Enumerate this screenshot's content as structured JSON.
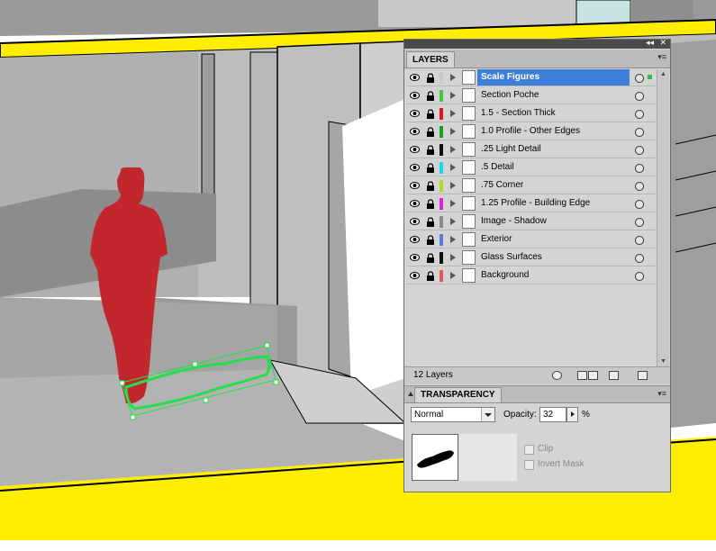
{
  "layers_panel": {
    "tab_label": "LAYERS",
    "collapse_glyph": "◂◂",
    "close_glyph": "✕",
    "menu_glyph": "▾≡",
    "count_label": "12 Layers",
    "layers": [
      {
        "label": "Scale Figures",
        "color": "#c8ccc8",
        "selected": true
      },
      {
        "label": "Section Poche",
        "color": "#3ccc3c",
        "selected": false
      },
      {
        "label": "1.5 - Section Thick",
        "color": "#e01818",
        "selected": false
      },
      {
        "label": "1.0 Profile - Other Edges",
        "color": "#1aa01a",
        "selected": false
      },
      {
        "label": ".25 Light Detail",
        "color": "#101010",
        "selected": false
      },
      {
        "label": ".5 Detail",
        "color": "#18d8e0",
        "selected": false
      },
      {
        "label": ".75 Corner",
        "color": "#a8e020",
        "selected": false
      },
      {
        "label": "1.25 Profile - Building Edge",
        "color": "#e020e0",
        "selected": false
      },
      {
        "label": "Image - Shadow",
        "color": "#8c8c8c",
        "selected": false
      },
      {
        "label": "Exterior",
        "color": "#5a7ae0",
        "selected": false
      },
      {
        "label": "Glass Surfaces",
        "color": "#101010",
        "selected": false
      },
      {
        "label": "Background",
        "color": "#e85858",
        "selected": false
      }
    ]
  },
  "transparency_panel": {
    "tab_label": "TRANSPARENCY",
    "blend_mode": "Normal",
    "opacity_label": "Opacity:",
    "opacity_value": "32",
    "opacity_unit": "%",
    "clip_label": "Clip",
    "invert_mask_label": "Invert Mask"
  },
  "colors": {
    "accent_yellow": "#ffee00",
    "figure_red": "#c1272d",
    "selection_green": "#22e04a",
    "selected_row": "#3d7fd9"
  }
}
